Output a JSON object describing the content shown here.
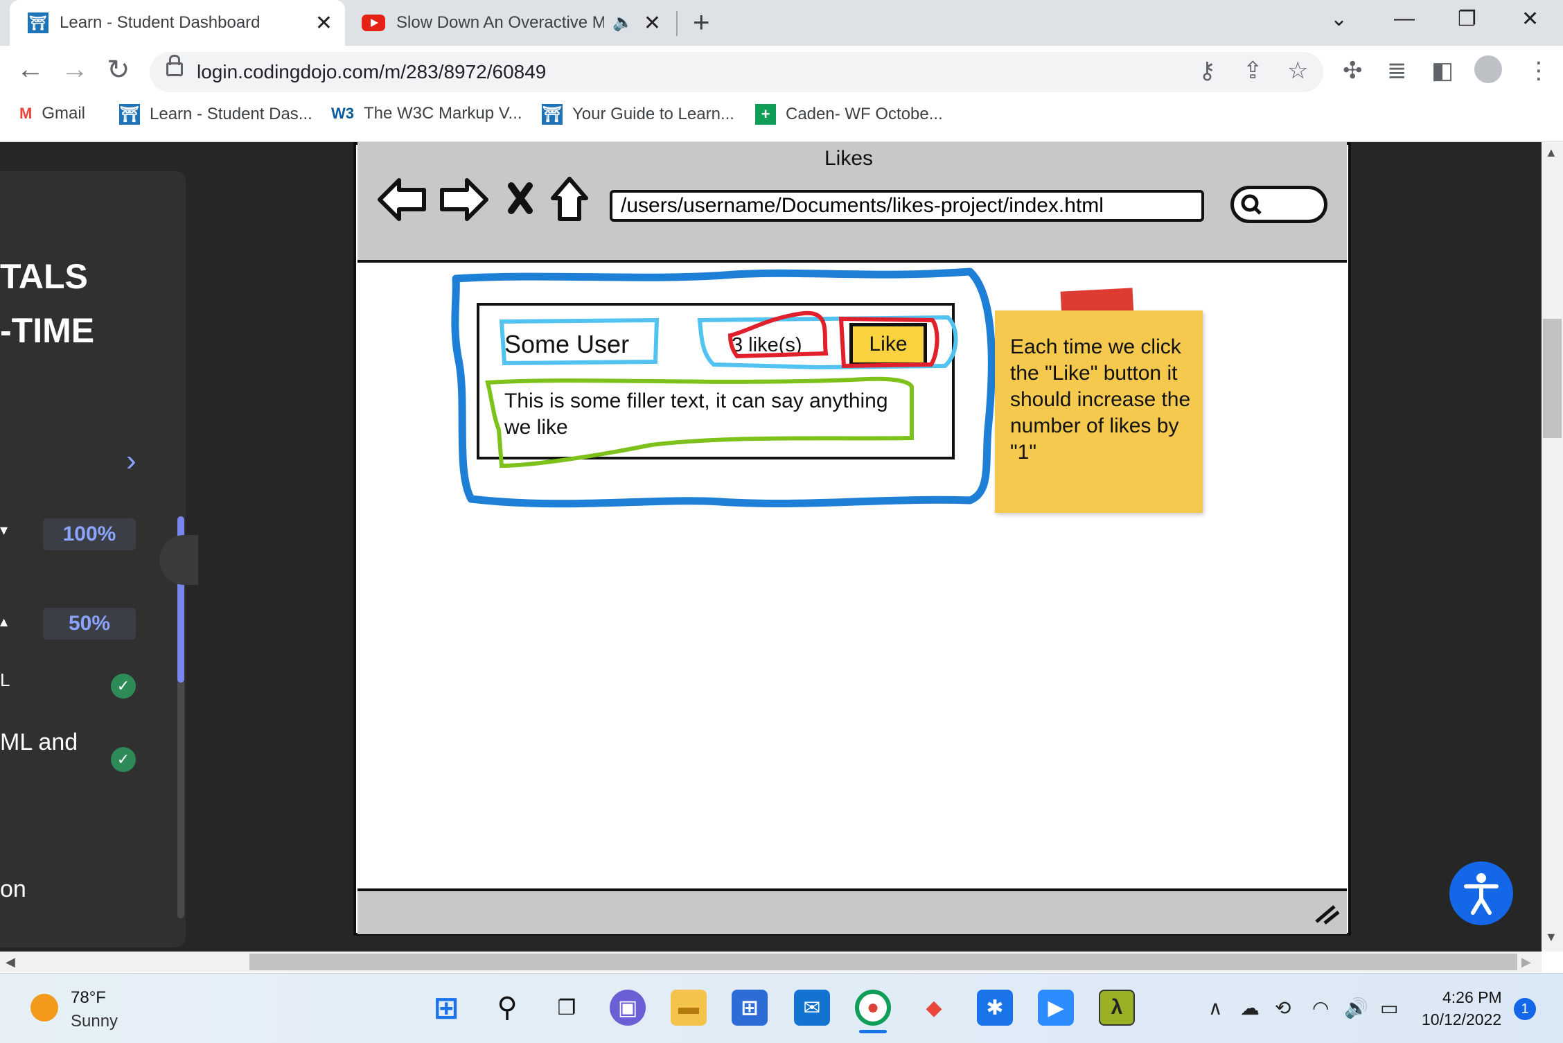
{
  "tabs": [
    {
      "title": "Learn - Student Dashboard",
      "favicon": "codingdojo-icon"
    },
    {
      "title": "Slow Down An Overactive Mi",
      "favicon": "youtube-icon"
    }
  ],
  "address_bar": {
    "url": "login.codingdojo.com/m/283/8972/60849"
  },
  "bookmarks": [
    {
      "label": "Gmail",
      "icon": "gmail-icon"
    },
    {
      "label": "Learn - Student Das...",
      "icon": "codingdojo-icon"
    },
    {
      "label": "The W3C Markup V...",
      "icon": "w3c-icon"
    },
    {
      "label": "Your Guide to Learn...",
      "icon": "codingdojo-icon"
    },
    {
      "label": "Caden- WF Octobe...",
      "icon": "sheets-icon"
    }
  ],
  "sidebar": {
    "heading_line1": "TALS",
    "heading_line2": "-TIME",
    "progress_1": "100%",
    "progress_2": "50%",
    "item_1": "L",
    "item_2": "ML and",
    "item_3": "on"
  },
  "wireframe": {
    "window_title": "Likes",
    "url": "/users/username/Documents/likes-project/index.html",
    "card": {
      "user": "Some User",
      "likes": "3 like(s)",
      "like_button": "Like",
      "body": "This is some filler text, it can say anything we like"
    },
    "sticky_note": "Each time we click the \"Like\" button it should increase the number of likes by \"1\""
  },
  "taskbar": {
    "temperature": "78°F",
    "condition": "Sunny",
    "time": "4:26 PM",
    "date": "10/12/2022",
    "notification_count": "1"
  },
  "colors": {
    "annotation_blue": "#1e7fd6",
    "annotation_light_blue": "#52c3f0",
    "annotation_red": "#e0202a",
    "annotation_green": "#7cc21a",
    "sticky_note": "#f4c94d"
  }
}
